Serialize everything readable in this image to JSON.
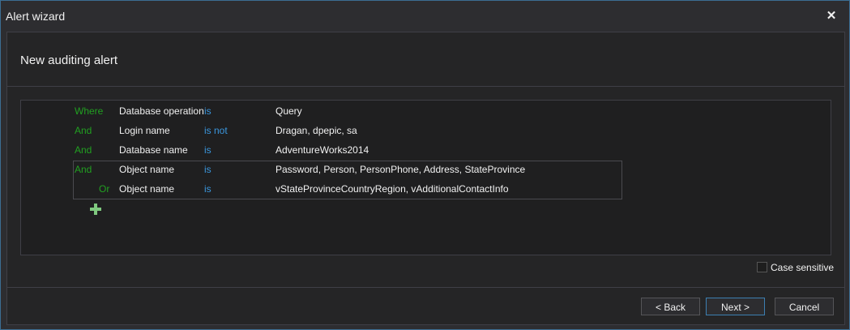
{
  "window": {
    "title": "Alert wizard",
    "close_glyph": "✕"
  },
  "header": {
    "title": "New auditing alert"
  },
  "filters": [
    {
      "op": "Where",
      "field": "Database operation",
      "cmp": "is",
      "value": "Query"
    },
    {
      "op": "And",
      "field": "Login name",
      "cmp": "is not",
      "value": "Dragan, dpepic, sa"
    },
    {
      "op": "And",
      "field": "Database name",
      "cmp": "is",
      "value": "AdventureWorks2014"
    },
    {
      "op": "And",
      "field": "Object name",
      "cmp": "is",
      "value": "Password, Person, PersonPhone, Address, StateProvince"
    },
    {
      "op": "Or",
      "field": "Object name",
      "cmp": "is",
      "value": "vStateProvinceCountryRegion, vAdditionalContactInfo"
    }
  ],
  "add_icon": "plus-icon",
  "options": {
    "case_sensitive_label": "Case sensitive",
    "case_sensitive_checked": false
  },
  "buttons": {
    "back": "< Back",
    "next": "Next >",
    "cancel": "Cancel"
  },
  "colors": {
    "operator": "#21a021",
    "comparison": "#3a96dd",
    "accent_border": "#3c7fb1"
  }
}
